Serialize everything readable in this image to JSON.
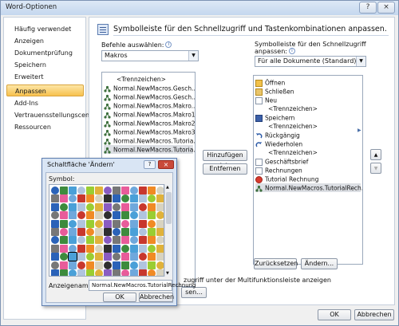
{
  "window": {
    "title": "Word-Optionen",
    "help_icon": "?",
    "close_icon": "×"
  },
  "nav": {
    "items": [
      "Häufig verwendet",
      "Anzeigen",
      "Dokumentprüfung",
      "Speichern",
      "Erweitert",
      "Anpassen",
      "Add-Ins",
      "Vertrauensstellungscenter",
      "Ressourcen"
    ],
    "selected_index": 5
  },
  "main": {
    "header": "Symbolleiste für den Schnellzugriff und Tastenkombinationen anpassen.",
    "commands_label": "Befehle auswählen:",
    "commands_value": "Makros",
    "toolbar_label_1": "Symbolleiste für den Schnellzugriff",
    "toolbar_label_2": "anpassen:",
    "toolbar_value": "Für alle Dokumente (Standard)",
    "left_list": [
      "<Trennzeichen>",
      "Normal.NewMacros.Gesch...",
      "Normal.NewMacros.Gesch...",
      "Normal.NewMacros.Makro...",
      "Normal.NewMacros.Makro1",
      "Normal.NewMacros.Makro2",
      "Normal.NewMacros.Makro3",
      "Normal.NewMacros.Tutoria...",
      "Normal.NewMacros.Tutoria..."
    ],
    "right_list": [
      "Öffnen",
      "Schließen",
      "Neu",
      "<Trennzeichen>",
      "Speichern",
      "<Trennzeichen>",
      "Rückgängig",
      "Wiederholen",
      "<Trennzeichen>",
      "Geschäftsbrief",
      "Rechnungen",
      "Tutorial Rechnung",
      "Normal.NewMacros.TutorialRech..."
    ],
    "add_button": "Hinzufügen >>",
    "remove_button": "Entfernen",
    "reset_button": "Zurücksetzen",
    "modify_button": "Ändern...",
    "show_below_text": "zugriff unter der Multifunktionsleiste anzeigen",
    "partial_button": "sen..."
  },
  "footer": {
    "ok": "OK",
    "cancel": "Abbrechen"
  },
  "dialog": {
    "title": "Schaltfläche 'Ändern'",
    "symbol_label": "Symbol:",
    "display_name_label": "Anzeigename:",
    "display_name_value": "Normal.NewMacros.TutorialRechnung",
    "ok": "OK",
    "cancel": "Abbrechen"
  },
  "colors": {
    "accent": "#f7c14e",
    "title_bg": "#c4d7ee"
  }
}
